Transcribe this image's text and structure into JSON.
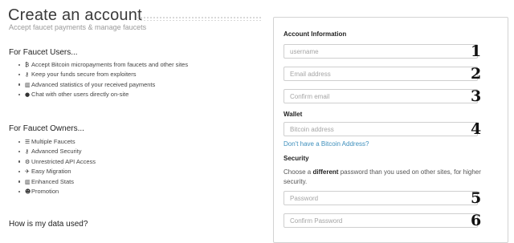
{
  "page": {
    "title": "Create an account",
    "subtitle": "Accept faucet payments & manage faucets"
  },
  "users_section": {
    "heading": "For Faucet Users...",
    "items": [
      {
        "icon": "bitcoin-icon",
        "glyph": "₿",
        "label": "Accept Bitcoin micropayments from faucets and other sites"
      },
      {
        "icon": "key-icon",
        "glyph": "⚷",
        "label": "Keep your funds secure from exploiters"
      },
      {
        "icon": "bar-chart-icon",
        "glyph": "▥",
        "label": "Advanced statistics of your received payments"
      },
      {
        "icon": "comments-icon",
        "glyph": "●",
        "label": "Chat with other users directly on-site"
      }
    ]
  },
  "owners_section": {
    "heading": "For Faucet Owners...",
    "items": [
      {
        "icon": "list-icon",
        "glyph": "☰",
        "label": "Multiple Faucets"
      },
      {
        "icon": "key-icon",
        "glyph": "⚷",
        "label": "Advanced Security"
      },
      {
        "icon": "gears-icon",
        "glyph": "⚙",
        "label": "Unrestricted API Access"
      },
      {
        "icon": "plane-icon",
        "glyph": "✈",
        "label": "Easy Migration"
      },
      {
        "icon": "bar-chart-icon",
        "glyph": "▥",
        "label": "Enhanced Stats"
      },
      {
        "icon": "users-icon",
        "glyph": "☻",
        "label": "Promotion"
      }
    ]
  },
  "data_section": {
    "heading": "How is my data used?"
  },
  "form": {
    "account_heading": "Account Information",
    "username": {
      "placeholder": "username",
      "value": "",
      "step": "1"
    },
    "email": {
      "placeholder": "Email address",
      "value": "",
      "step": "2"
    },
    "confirm_email": {
      "placeholder": "Confirm email",
      "value": "",
      "step": "3"
    },
    "wallet_heading": "Wallet",
    "bitcoin_address": {
      "placeholder": "Bitcoin address",
      "value": "",
      "step": "4"
    },
    "no_address_link": "Don't have a Bitcoin Address?",
    "security_heading": "Security",
    "security_help": {
      "before": "Choose a ",
      "emphasis": "different",
      "after": " password than you used on other sites, for higher security."
    },
    "password": {
      "placeholder": "Password",
      "value": "",
      "step": "5"
    },
    "confirm_password": {
      "placeholder": "Confirm Password",
      "value": "",
      "step": "6"
    }
  },
  "colors": {
    "link": "#3d8fbc",
    "border": "#cfcfcf",
    "title": "#3a3a3a"
  }
}
